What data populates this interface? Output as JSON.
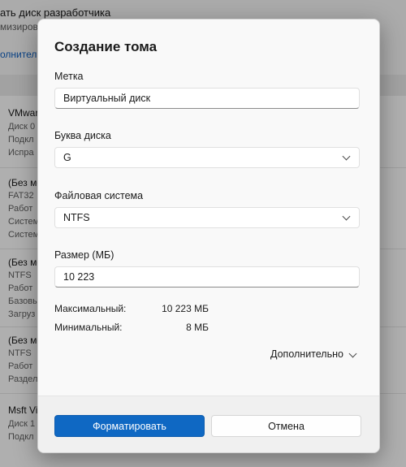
{
  "background": {
    "title_fragment": "ать диск разработчика",
    "subtitle_fragment": "мизирова",
    "link_fragment": "олнитель",
    "groups": [
      {
        "title": "VMwar",
        "lines": [
          "Диск 0",
          "Подкл",
          "Испра"
        ]
      },
      {
        "title": "(Без ме",
        "lines": [
          "FAT32",
          "Работ",
          "Систем",
          "Систем"
        ]
      },
      {
        "title": "(Без ме",
        "lines": [
          "NTFS",
          "Работ",
          "Базовы",
          "Загруз"
        ]
      },
      {
        "title": "(Без ме",
        "lines": [
          "NTFS",
          "Работ",
          "Раздел"
        ]
      },
      {
        "title": "Msft Vi",
        "lines": [
          "Диск 1",
          "Подкл"
        ]
      }
    ]
  },
  "dialog": {
    "title": "Создание тома",
    "label_field": {
      "label": "Метка",
      "value": "Виртуальный диск"
    },
    "drive_letter": {
      "label": "Буква диска",
      "value": "G"
    },
    "file_system": {
      "label": "Файловая система",
      "value": "NTFS"
    },
    "size": {
      "label": "Размер (МБ)",
      "value": "10 223"
    },
    "max": {
      "label": "Максимальный:",
      "value": "10 223 МБ"
    },
    "min": {
      "label": "Минимальный:",
      "value": "8 МБ"
    },
    "more_label": "Дополнительно",
    "format_button": "Форматировать",
    "cancel_button": "Отмена"
  },
  "colors": {
    "accent": "#0f68c3",
    "dialog_bg": "#f9f9f9",
    "overlay": "rgba(0,0,0,0.30)"
  }
}
